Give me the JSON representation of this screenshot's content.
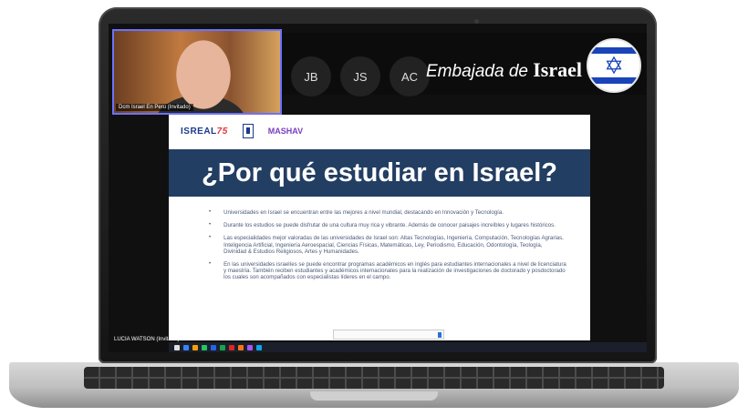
{
  "meeting": {
    "video_name": "Dcm Israel En Peru (Invitado)",
    "participants": [
      {
        "initials": "JB"
      },
      {
        "initials": "JS"
      },
      {
        "initials": "AC"
      }
    ],
    "self_name": "LUCIA WATSON (Invitado)"
  },
  "banner": {
    "embassy_light": "Embajada de",
    "embassy_bold": "Israel",
    "star_icon": "✡"
  },
  "slide": {
    "logo_isreal": "ISREAL",
    "logo_75": "75",
    "logo_mashav": "MASHAV",
    "title": "¿Por qué estudiar en Israel?",
    "bullets": [
      "Universidades en Israel se encuentran entre las mejores a nivel mundial, destacando en Innovación y Tecnología.",
      "Durante los estudios se puede disfrutar de una cultura muy rica y vibrante. Además de conocer paisajes increíbles y lugares históricos.",
      "Las especialidades mejor valoradas de las universidades de Israel son: Altas Tecnologías, Ingeniería, Computación, Tecnologías Agrarias, Inteligencia Artificial, Ingeniería Aeroespacial, Ciencias Físicas, Matemáticas, Ley, Periodismo, Educación, Odontología, Teología, Divinidad & Estudios Religiosos, Artes y Humanidades.",
      "En las universidades israelíes se puede encontrar programas académicos en inglés para estudiantes internacionales a nivel de licenciatura y maestría. También reciben estudiantes y académicos internacionales para la realización de investigaciones de doctorado y posdoctorado los cuales son acompañados con especialistas líderes en el campo."
    ]
  },
  "colors": {
    "title_band": "#233e63",
    "bullet_text": "#4a5a78",
    "flag_blue": "#1a44b8",
    "video_border": "#6a73ff"
  }
}
